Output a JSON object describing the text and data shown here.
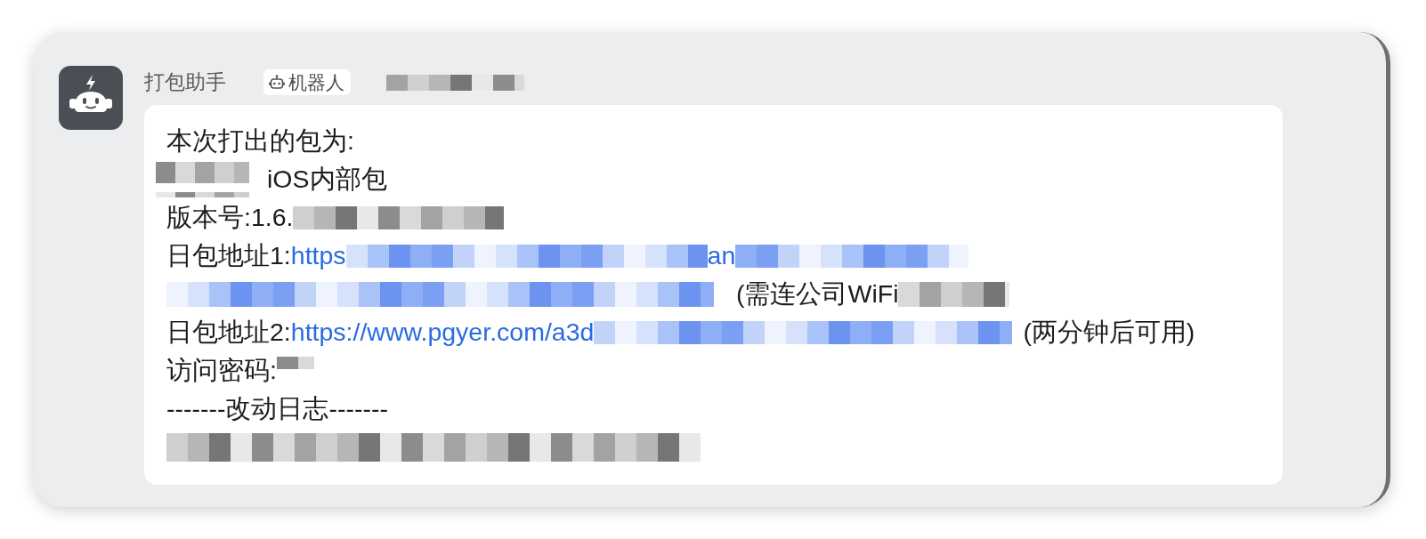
{
  "sender": {
    "name": "打包助手",
    "badge": "机器人",
    "details_redacted": true
  },
  "message": {
    "lines": [
      [
        {
          "kind": "text",
          "text": "本次打出的包为:"
        }
      ],
      [
        {
          "kind": "mosaic"
        },
        {
          "kind": "text",
          "text": "iOS内部包"
        }
      ],
      [
        {
          "kind": "text",
          "text": "版本号:1.6."
        },
        {
          "kind": "mosaic"
        }
      ],
      [
        {
          "kind": "text",
          "text": "日包地址1:"
        },
        {
          "kind": "link",
          "text": "https"
        },
        {
          "kind": "link_mosaic"
        },
        {
          "kind": "link",
          "text": "an"
        },
        {
          "kind": "link_mosaic"
        }
      ],
      [
        {
          "kind": "link_mosaic"
        },
        {
          "kind": "text",
          "text": "(需连公司WiFi"
        },
        {
          "kind": "mosaic"
        }
      ],
      [
        {
          "kind": "text",
          "text": "日包地址2:"
        },
        {
          "kind": "link",
          "text": "https://www.pgyer.com/a3d"
        },
        {
          "kind": "link_mosaic"
        },
        {
          "kind": "text",
          "text": "(两分钟后可用)"
        }
      ],
      [
        {
          "kind": "text",
          "text": "访问密码:"
        },
        {
          "kind": "mosaic"
        }
      ],
      [
        {
          "kind": "text",
          "text": "-------改动日志-------"
        }
      ],
      [
        {
          "kind": "mosaic"
        }
      ]
    ]
  }
}
